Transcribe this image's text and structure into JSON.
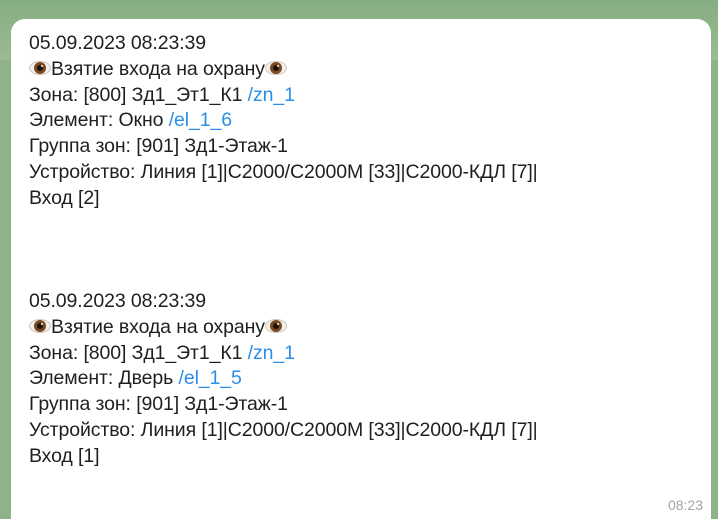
{
  "chat": {
    "messages": [
      {
        "datetime": "05.09.2023 08:23:39",
        "event_label": "Взятие входа на охрану",
        "zone_text": "Зона: [800] Зд1_Эт1_К1 ",
        "zone_link": "/zn_1",
        "element_text": "Элемент: Окно ",
        "element_link": "/el_1_6",
        "group_text": "Группа зон: [901] Зд1-Этаж-1",
        "device_line1": "Устройство: Линия [1]|С2000/С2000М [33]|С2000-КДЛ [7]|",
        "device_line2": "Вход [2]"
      },
      {
        "datetime": "05.09.2023 08:23:39",
        "event_label": "Взятие входа на охрану",
        "zone_text": "Зона: [800] Зд1_Эт1_К1 ",
        "zone_link": "/zn_1",
        "element_text": "Элемент: Дверь ",
        "element_link": "/el_1_5",
        "group_text": "Группа зон: [901] Зд1-Этаж-1",
        "device_line1": "Устройство: Линия [1]|С2000/С2000М [33]|С2000-КДЛ [7]|",
        "device_line2": "Вход [1]"
      }
    ],
    "timestamp": "08:23",
    "icons": {
      "event_icon": "eye-icon"
    },
    "colors": {
      "link": "#2b8ee8",
      "text": "#1f1f1f",
      "bubble": "#ffffff",
      "timestamp": "#a3a3a3"
    }
  }
}
